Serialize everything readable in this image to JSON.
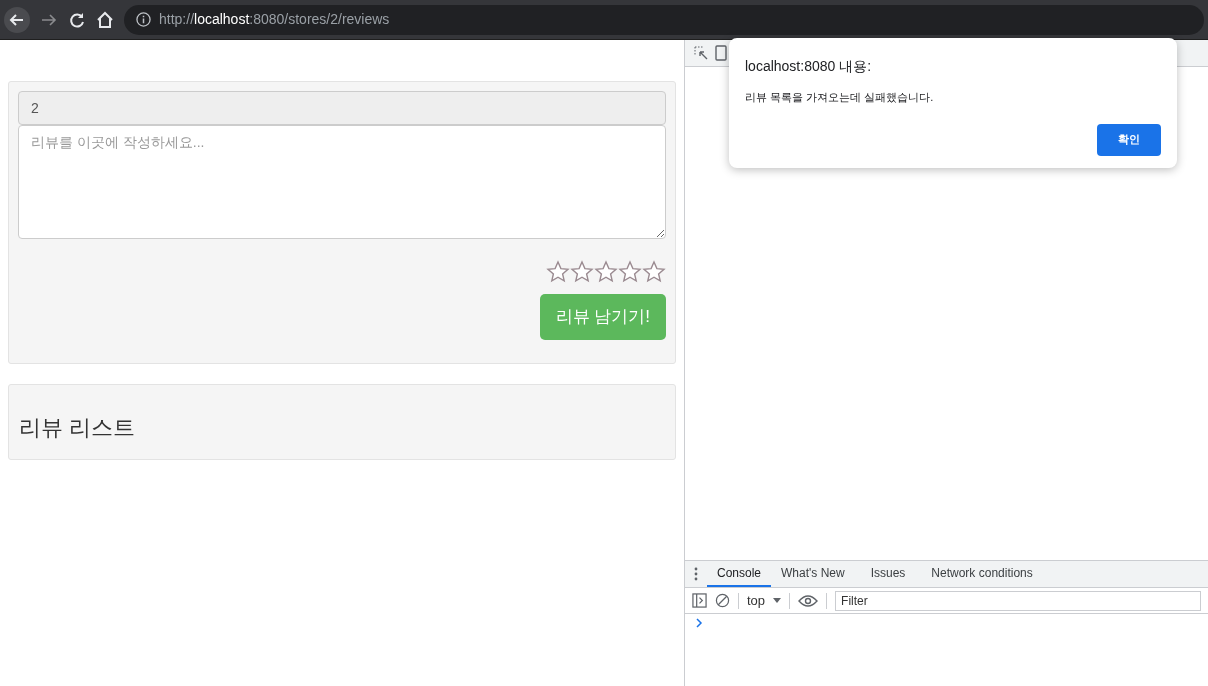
{
  "browser": {
    "url": "http://**localhost**:8080/stores/2/reviews"
  },
  "review_form": {
    "store_id": "2",
    "placeholder": "리뷰를 이곳에 작성하세요...",
    "stars": 0,
    "submit": "리뷰 남기기!"
  },
  "review_list": {
    "title": "리뷰 리스트"
  },
  "dialog": {
    "title": "localhost:8080 내용:",
    "message": "리뷰 목록을 가져오는데 실패했습니다.",
    "button": "확인"
  },
  "devtools": {
    "tabs": [
      {
        "label": "Console",
        "selected": true
      },
      {
        "label": "What's New",
        "selected": false
      },
      {
        "label": "Issues",
        "selected": false
      },
      {
        "label": "Network conditions",
        "selected": false
      }
    ],
    "context": "top",
    "filter_placeholder": "Filter"
  }
}
